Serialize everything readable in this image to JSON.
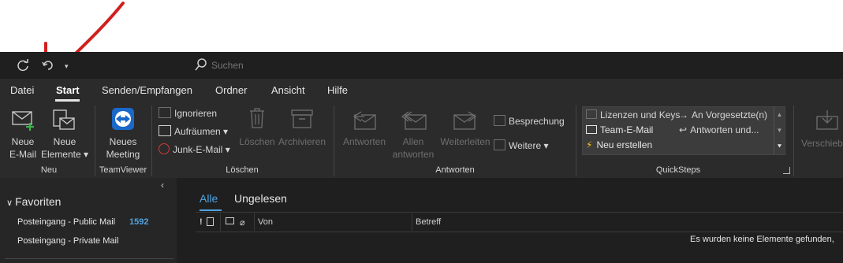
{
  "titlebar": {
    "search_placeholder": "Suchen"
  },
  "tabs": [
    {
      "label": "Datei"
    },
    {
      "label": "Start"
    },
    {
      "label": "Senden/Empfangen"
    },
    {
      "label": "Ordner"
    },
    {
      "label": "Ansicht"
    },
    {
      "label": "Hilfe"
    }
  ],
  "ribbon": {
    "neu": {
      "new_email_l1": "Neue",
      "new_email_l2": "E-Mail",
      "new_items_l1": "Neue",
      "new_items_l2": "Elemente",
      "group": "Neu"
    },
    "teamviewer": {
      "l1": "Neues",
      "l2": "Meeting",
      "group": "TeamViewer"
    },
    "loeschen": {
      "ignore": "Ignorieren",
      "cleanup": "Aufräumen",
      "junk": "Junk-E-Mail",
      "delete": "Löschen",
      "archive": "Archivieren",
      "group": "Löschen"
    },
    "antworten": {
      "reply": "Antworten",
      "reply_all_l1": "Allen",
      "reply_all_l2": "antworten",
      "forward": "Weiterleiten",
      "meeting": "Besprechung",
      "more": "Weitere",
      "group": "Antworten"
    },
    "quicksteps": {
      "items": [
        "Lizenzen und Keys",
        "Team-E-Mail",
        "Neu erstellen",
        "An Vorgesetzte(n)",
        "Antworten und..."
      ],
      "group": "QuickSteps"
    },
    "verschieben": {
      "label": "Verschieben"
    }
  },
  "sidebar": {
    "favorites": "Favoriten",
    "items": [
      {
        "label": "Posteingang - Public Mail",
        "count": "1592"
      },
      {
        "label": "Posteingang - Private Mail"
      }
    ]
  },
  "maillist": {
    "filters": [
      "Alle",
      "Ungelesen"
    ],
    "columns": {
      "from": "Von",
      "subject": "Betreff"
    },
    "empty": "Es wurden keine Elemente gefunden,"
  },
  "colors": {
    "accent": "#4fa3e0",
    "annotation": "#d0201d"
  }
}
